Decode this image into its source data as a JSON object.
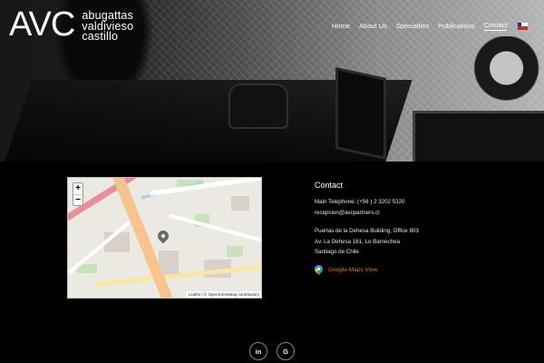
{
  "logo": {
    "mark": "AVC",
    "lines": [
      "abugattas",
      "valdivieso",
      "castillo"
    ]
  },
  "nav": {
    "items": [
      "Home",
      "About Us",
      "Specialties",
      "Publications",
      "Contact"
    ],
    "active": "Contact",
    "language_flag": "chile-flag-icon"
  },
  "map": {
    "zoom_in": "+",
    "zoom_out": "−",
    "attribution": "Leaflet | © OpenStreetMap contributors"
  },
  "contact": {
    "title": "Contact",
    "phone": "Main Telephone: (+56 ) 2 3202 5320",
    "email": "recepcion@avcpartners.cl",
    "address_1": "Puertas de la Dehesa Building, Office 803",
    "address_2": "Av. La Dehesa 181, Lo Barnechea",
    "address_3": "Santiago de Chile",
    "gmaps_label": "Google Maps View"
  },
  "social": {
    "linkedin": "in",
    "google": "G"
  },
  "colors": {
    "background": "#000000",
    "link_accent": "#e07a2f"
  }
}
